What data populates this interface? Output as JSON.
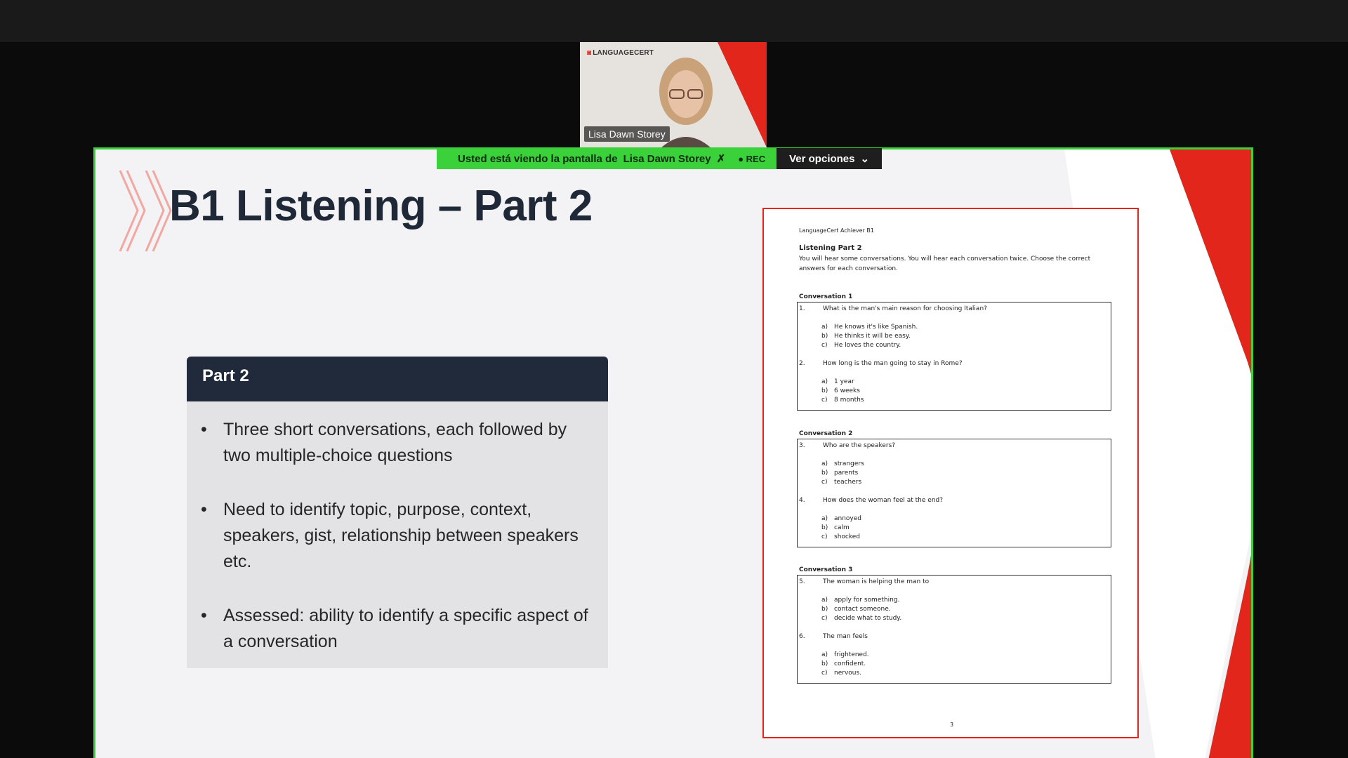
{
  "meeting": {
    "participant_name": "Lisa Dawn Storey",
    "tile_logo": "LANGUAGECERT",
    "banner_prefix": "Usted está viendo la pantalla de",
    "banner_name": "Lisa Dawn Storey",
    "rec_label": "REC",
    "options_label": "Ver opciones"
  },
  "slide": {
    "title": "B1 Listening – Part 2",
    "box_heading": "Part 2",
    "bullets": [
      "Three short conversations, each followed by two multiple-choice questions",
      "Need to identify topic, purpose, context, speakers, gist, relationship between speakers etc.",
      "Assessed: ability to identify a specific aspect of a conversation"
    ]
  },
  "paper": {
    "header": "LanguageCert Achiever B1",
    "title": "Listening Part 2",
    "intro": "You will hear some conversations. You will hear each conversation twice. Choose the correct answers for each conversation.",
    "conversations": [
      {
        "title": "Conversation 1",
        "questions": [
          {
            "num": "1.",
            "text": "What is the man's main reason for choosing Italian?",
            "options": [
              "He knows it's like Spanish.",
              "He thinks it will be easy.",
              "He loves the country."
            ]
          },
          {
            "num": "2.",
            "text": "How long is the man going to stay in Rome?",
            "options": [
              "1 year",
              "6 weeks",
              "8 months"
            ]
          }
        ]
      },
      {
        "title": "Conversation 2",
        "questions": [
          {
            "num": "3.",
            "text": "Who are the speakers?",
            "options": [
              "strangers",
              "parents",
              "teachers"
            ]
          },
          {
            "num": "4.",
            "text": "How does the woman feel at the end?",
            "options": [
              "annoyed",
              "calm",
              "shocked"
            ]
          }
        ]
      },
      {
        "title": "Conversation 3",
        "questions": [
          {
            "num": "5.",
            "text": "The woman is helping the man to",
            "options": [
              "apply for something.",
              "contact someone.",
              "decide what to study."
            ]
          },
          {
            "num": "6.",
            "text": "The man feels",
            "options": [
              "frightened.",
              "confident.",
              "nervous."
            ]
          }
        ]
      }
    ],
    "option_letters": [
      "a)",
      "b)",
      "c)"
    ],
    "page_number": "3"
  },
  "colors": {
    "accent_red": "#e3261b",
    "share_green": "#3ad13a",
    "heading_navy": "#212a3a"
  }
}
